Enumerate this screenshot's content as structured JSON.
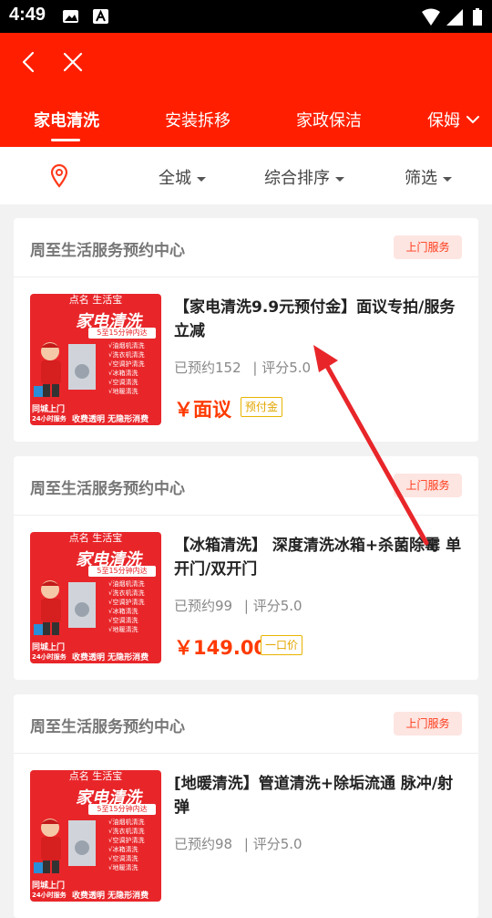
{
  "status_bar": {
    "time": "4:49"
  },
  "tabs": [
    {
      "label": "家电清洗"
    },
    {
      "label": "安装拆移"
    },
    {
      "label": "家政保洁"
    },
    {
      "label": "保姆"
    }
  ],
  "filters": {
    "city": "全城",
    "sort": "综合排序",
    "filter": "筛选"
  },
  "cards": [
    {
      "shop": "周至生活服务预约中心",
      "badge": "上门服务",
      "title": "【家电清洗9.9元预付金】面议专拍/服务立减",
      "booked": "已预约152",
      "rating": "| 评分5.0",
      "price": "￥面议",
      "tag": "预付金"
    },
    {
      "shop": "周至生活服务预约中心",
      "badge": "上门服务",
      "title": "【冰箱清洗】 深度清洗冰箱+杀菌除霉 单开门/双开门",
      "booked": "已预约99",
      "rating": "| 评分5.0",
      "price": "￥149.00",
      "tag": "一口价"
    },
    {
      "shop": "周至生活服务预约中心",
      "badge": "上门服务",
      "title": "[地暖清洗】管道清洗+除垢流通 脉冲/射弹",
      "booked": "已预约98",
      "rating": "| 评分5.0",
      "price": "",
      "tag": ""
    }
  ],
  "thumbnail": {
    "top": "点名  生活宝",
    "title": "家电清洗",
    "sub": "5至15分钟内达",
    "list": [
      "√油烟机清洗",
      "√洗衣机清洗",
      "√空调护清洗",
      "√冰箱清洗",
      "√空调清洗",
      "√地暖清洗"
    ],
    "left": "同城上门",
    "left2": "24小时服务",
    "foot": "收费透明  无隐形消费"
  },
  "colors": {
    "brand": "#ff1f00",
    "price": "#ff3a00",
    "tag": "#e3a600"
  }
}
